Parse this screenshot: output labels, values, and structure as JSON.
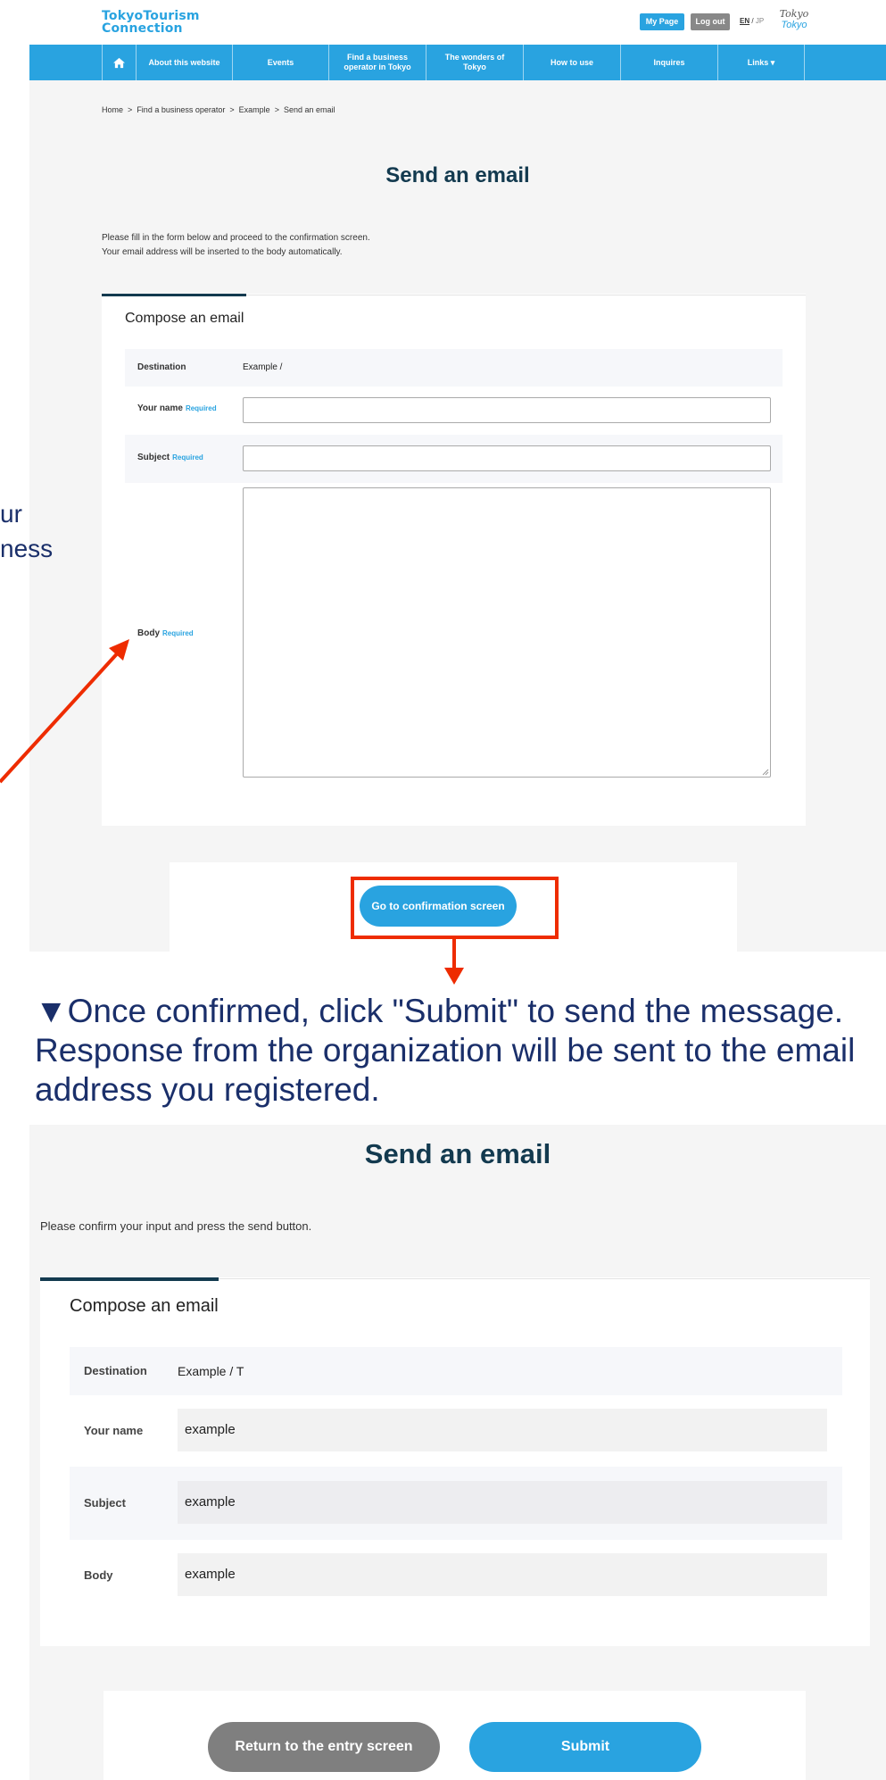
{
  "site": {
    "logo_line1": "TokyoTourism",
    "logo_line2": "Connection",
    "my_page_label": "My Page",
    "logout_label": "Log out",
    "lang_en": "EN",
    "lang_sep": "/",
    "lang_jp": "JP",
    "brand_line1": "Tokyo",
    "brand_line2": "Tokyo",
    "accent_color": "#29a3e0",
    "title_color": "#133a4f"
  },
  "nav": {
    "items": [
      {
        "label": "About this website"
      },
      {
        "label": "Events"
      },
      {
        "label": "Find a business operator in Tokyo"
      },
      {
        "label": "The wonders of Tokyo"
      },
      {
        "label": "How to use"
      },
      {
        "label": "Inquires"
      },
      {
        "label": "Links ▾"
      }
    ]
  },
  "breadcrumb": {
    "items": [
      "Home",
      "Find a business operator",
      "Example",
      "Send an email"
    ],
    "separator": ">"
  },
  "entry": {
    "title": "Send an email",
    "intro_line1": "Please fill in the form below and proceed to the confirmation screen.",
    "intro_line2": "Your email address will be inserted to the body automatically.",
    "card_title": "Compose an email",
    "required_label": "Required",
    "fields": {
      "destination_label": "Destination",
      "destination_value": "Example /",
      "name_label": "Your name",
      "subject_label": "Subject",
      "body_label": "Body"
    },
    "confirm_button": "Go to confirmation screen"
  },
  "side_text": {
    "line1": "ur",
    "line2": "ness"
  },
  "caption": {
    "line1": "▼Once confirmed, click \"Submit\" to send the message.",
    "line2": "Response from the organization will be sent to the email",
    "line3": "address you registered."
  },
  "confirm": {
    "title": "Send an email",
    "intro": "Please confirm your input and press the send button.",
    "card_title": "Compose an email",
    "fields": {
      "destination_label": "Destination",
      "destination_value": "Example / T",
      "name_label": "Your name",
      "name_value": "example",
      "subject_label": "Subject",
      "subject_value": "example",
      "body_label": "Body",
      "body_value": "example"
    },
    "return_button": "Return to the entry screen",
    "submit_button": "Submit"
  },
  "annotation": {
    "highlight_color": "#ee2c00",
    "caption_color": "#1a2f6a"
  }
}
